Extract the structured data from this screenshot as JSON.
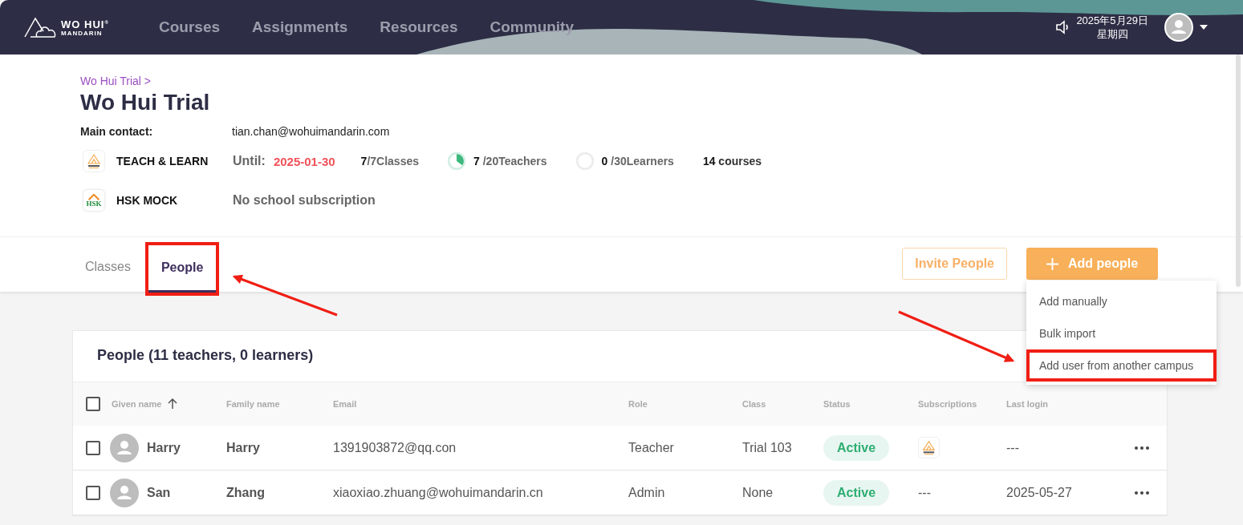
{
  "header": {
    "logo": {
      "line1": "WO HUI",
      "mark": "®",
      "line2": "MANDARIN"
    },
    "nav": [
      {
        "label": "Courses",
        "selected": false
      },
      {
        "label": "Assignments",
        "selected": false
      },
      {
        "label": "Resources",
        "selected": false
      },
      {
        "label": "Community",
        "selected": false
      }
    ],
    "date": "2025年5月29日",
    "weekday": "星期四"
  },
  "breadcrumb": "Wo Hui Trial >",
  "title": "Wo Hui Trial",
  "main_contact": {
    "label": "Main contact:",
    "value": "tian.chan@wohuimandarin.com"
  },
  "products": [
    {
      "kind": "teach",
      "name": "TEACH & LEARN",
      "until_label": "Until:",
      "until": "2025-01-30",
      "classes_used": "7",
      "classes_total": "/7Classes",
      "usage": [
        {
          "used": "7",
          "total": "/20Teachers",
          "level": 0.35
        },
        {
          "used": "0",
          "total": "/30Learners"
        }
      ],
      "courses_count": "14",
      "courses_label": "courses"
    },
    {
      "kind": "hsk",
      "name": "HSK MOCK",
      "icon_text": "HSK",
      "status": "No school subscription"
    }
  ],
  "tabs": [
    {
      "label": "Classes",
      "selected": false,
      "highlighted": false
    },
    {
      "label": "People",
      "selected": true,
      "highlighted": true
    }
  ],
  "invite_button": "Invite People",
  "add_button": "Add people",
  "add_menu": [
    {
      "label": "Add manually",
      "highlighted": false
    },
    {
      "label": "Bulk import",
      "highlighted": false
    },
    {
      "label": "Add user from another campus",
      "highlighted": true
    }
  ],
  "people": {
    "title": "People (11 teachers, 0 learners)",
    "select_all_checked": false,
    "columns": [
      "Given name",
      "Family name",
      "Email",
      "Role",
      "Class",
      "Status",
      "Subscriptions",
      "Last login"
    ],
    "rows": [
      {
        "checked": false,
        "given": "Harry",
        "family": "Harry",
        "email": "1391903872@qq.con",
        "role": "Teacher",
        "class": "Trial 103",
        "status": "Active",
        "subscription": true,
        "last_login": "---"
      },
      {
        "checked": false,
        "given": "San",
        "family": "Zhang",
        "email": "xiaoxiao.zhuang@wohuimandarin.cn",
        "role": "Admin",
        "class": "None",
        "status": "Active",
        "subscription": false,
        "subscription_text": "---",
        "last_login": "2025-05-27"
      }
    ]
  }
}
